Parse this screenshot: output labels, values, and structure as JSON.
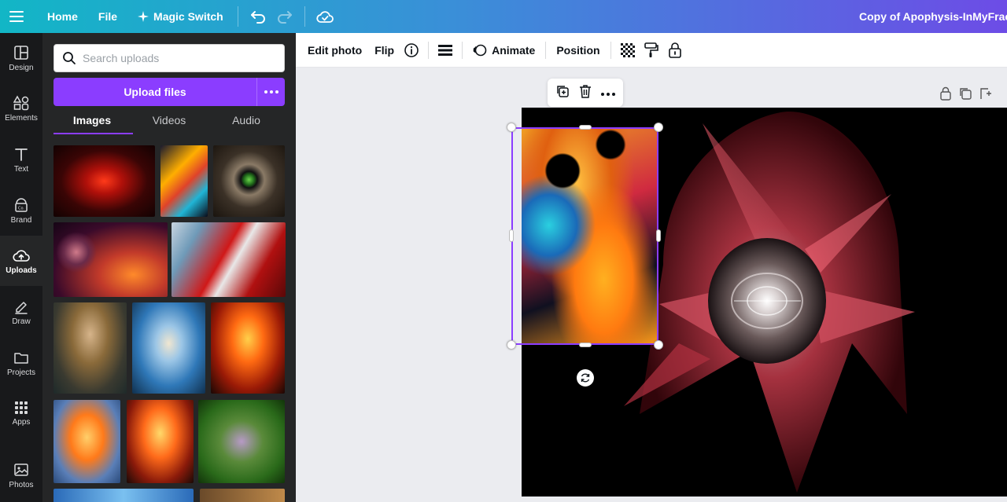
{
  "topbar": {
    "home": "Home",
    "file": "File",
    "magic_switch": "Magic Switch",
    "title": "Copy of Apophysis-InMyFracta"
  },
  "rail": {
    "items": [
      {
        "label": "Design",
        "icon": "layout-icon"
      },
      {
        "label": "Elements",
        "icon": "shapes-icon"
      },
      {
        "label": "Text",
        "icon": "text-icon"
      },
      {
        "label": "Brand",
        "icon": "brand-icon"
      },
      {
        "label": "Uploads",
        "icon": "cloud-upload-icon"
      },
      {
        "label": "Draw",
        "icon": "pen-icon"
      },
      {
        "label": "Projects",
        "icon": "folder-icon"
      },
      {
        "label": "Apps",
        "icon": "grid-icon"
      },
      {
        "label": "Photos",
        "icon": "photo-icon"
      }
    ],
    "active": "Uploads"
  },
  "panel": {
    "search_placeholder": "Search uploads",
    "upload_button": "Upload files",
    "tabs": [
      "Images",
      "Videos",
      "Audio"
    ],
    "active_tab": "Images"
  },
  "toolbar": {
    "edit_photo": "Edit photo",
    "flip": "Flip",
    "animate": "Animate",
    "position": "Position"
  },
  "colors": {
    "accent": "#8b3dff",
    "topbar_start": "#12b6c6",
    "topbar_end": "#6d4ce6",
    "rail_bg": "#18191b",
    "panel_bg": "#252627"
  }
}
